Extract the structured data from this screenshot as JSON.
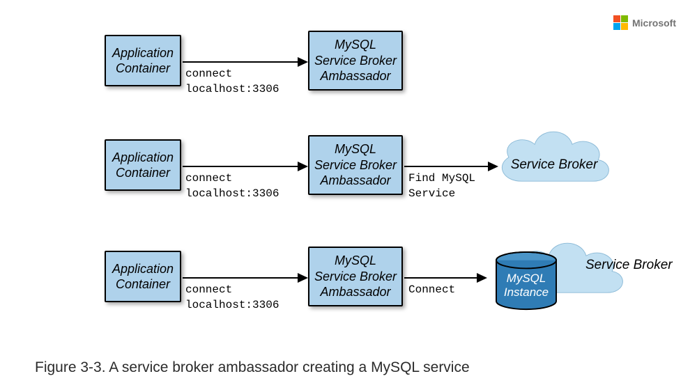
{
  "logo": {
    "name": "Microsoft"
  },
  "rows": [
    {
      "app": "Application\nContainer",
      "amb": "MySQL\nService Broker\nAmbassador",
      "conn1": "connect\nlocalhost:3306",
      "has_cloud": false
    },
    {
      "app": "Application\nContainer",
      "amb": "MySQL\nService Broker\nAmbassador",
      "conn1": "connect\nlocalhost:3306",
      "conn2": "Find MySQL\nService",
      "cloud_label": "Service\nBroker",
      "has_cloud": true,
      "has_db": false
    },
    {
      "app": "Application\nContainer",
      "amb": "MySQL\nService Broker\nAmbassador",
      "conn1": "connect\nlocalhost:3306",
      "conn2": "Connect",
      "cloud_label": "Service\nBroker",
      "db_label": "MySQL\nInstance",
      "has_cloud": true,
      "has_db": true
    }
  ],
  "caption": "Figure 3-3. A service broker ambassador creating a MySQL service"
}
